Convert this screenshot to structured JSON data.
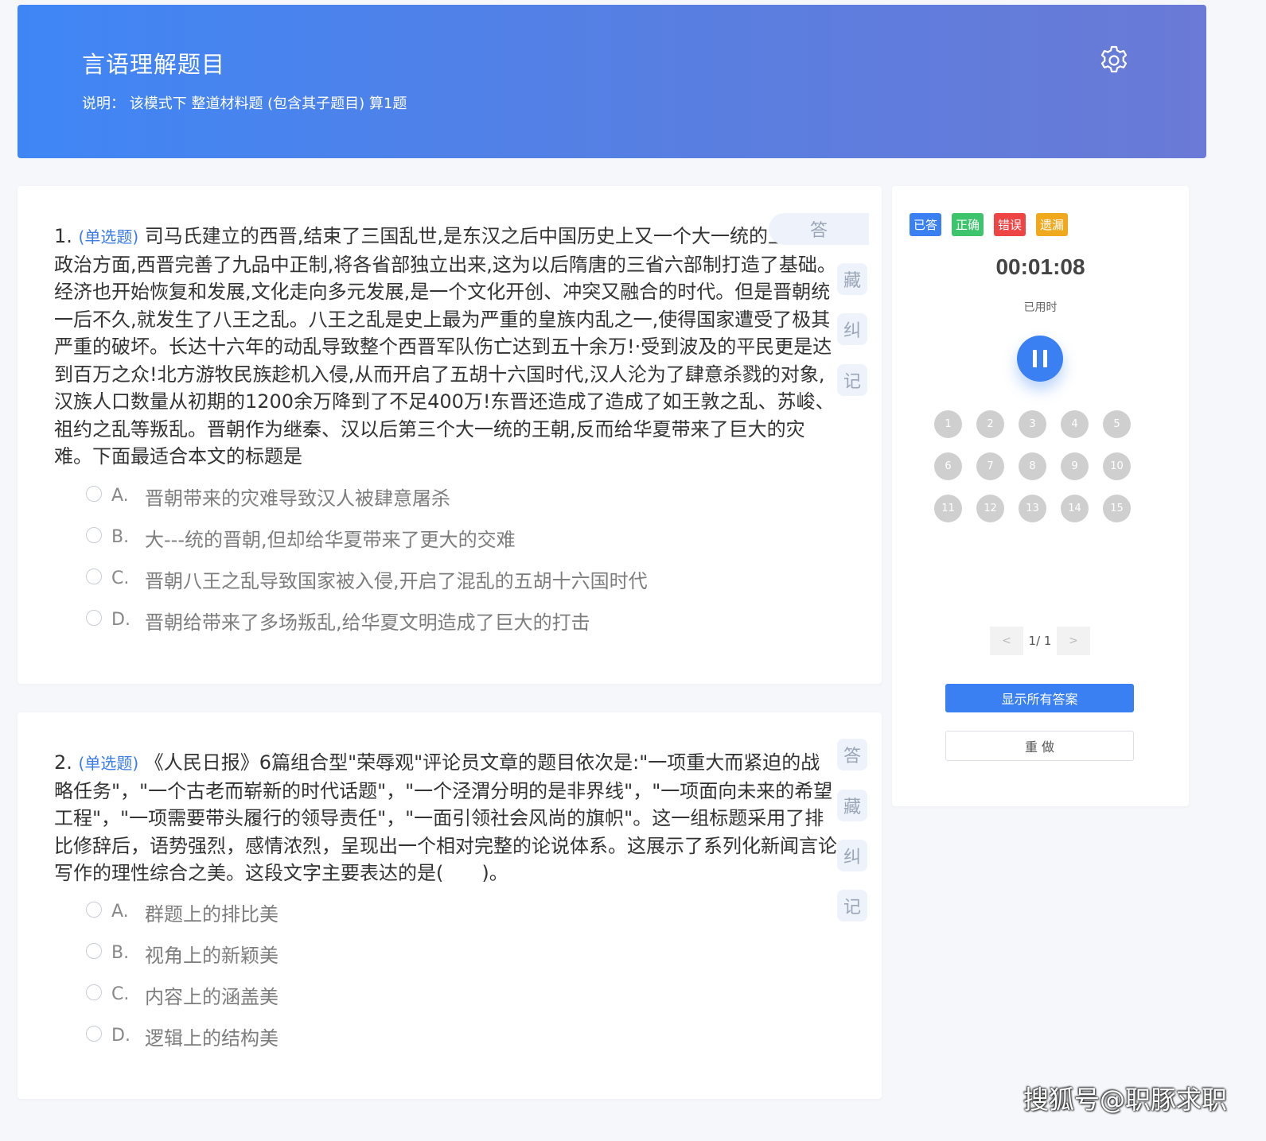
{
  "header": {
    "title": "言语理解题目",
    "note": "说明：  该模式下 整道材料题 (包含其子题目) 算1题",
    "settings_icon": "gear-icon"
  },
  "questions": [
    {
      "number": "1.",
      "type": "(单选题)",
      "stem": "司马氏建立的西晋,结束了三国乱世,是东汉之后中国历史上又一个大一统的王朝。政治方面,西晋完善了九品中正制,将各省部独立出来,这为以后隋唐的三省六部制打造了基础。经济也开始恢复和发展,文化走向多元发展,是一个文化开创、冲突又融合的时代。但是晋朝统一后不久,就发生了八王之乱。八王之乱是史上最为严重的皇族内乱之一,使得国家遭受了极其严重的破坏。长达十六年的动乱导致整个西晋军队伤亡达到五十余万!·受到波及的平民更是达到百万之众!北方游牧民族趁机入侵,从而开启了五胡十六国时代,汉人沦为了肆意杀戮的对象,汉族人口数量从初期的1200余万降到了不足400万!东晋还造成了造成了如王敦之乱、苏峻、祖约之乱等叛乱。晋朝作为继秦、汉以后第三个大一统的王朝,反而给华夏带来了巨大的灾难。下面最适合本文的标题是",
      "options": [
        {
          "key": "A.",
          "text": "晋朝带来的灾难导致汉人被肆意屠杀"
        },
        {
          "key": "B.",
          "text": "大---统的晋朝,但却给华夏带来了更大的交难"
        },
        {
          "key": "C.",
          "text": "晋朝八王之乱导致国家被入侵,开启了混乱的五胡十六国时代"
        },
        {
          "key": "D.",
          "text": "晋朝给带来了多场叛乱,给华夏文明造成了巨大的打击"
        }
      ],
      "side_buttons": [
        "答",
        "藏",
        "纠",
        "记"
      ]
    },
    {
      "number": "2.",
      "type": "(单选题)",
      "stem": "《人民日报》6篇组合型\"荣辱观\"评论员文章的题目依次是:\"一项重大而紧迫的战略任务\"，\"一个古老而崭新的时代话题\"，\"一个泾渭分明的是非界线\"，\"一项面向未来的希望工程\"，\"一项需要带头履行的领导责任\"，\"一面引领社会风尚的旗帜\"。这一组标题采用了排比修辞后，语势强烈，感情浓烈，呈现出一个相对完整的论说体系。这展示了系列化新闻言论写作的理性综合之美。这段文字主要表达的是(　　)。",
      "options": [
        {
          "key": "A.",
          "text": "群题上的排比美"
        },
        {
          "key": "B.",
          "text": "视角上的新颖美"
        },
        {
          "key": "C.",
          "text": "内容上的涵盖美"
        },
        {
          "key": "D.",
          "text": "逻辑上的结构美"
        }
      ],
      "side_buttons": [
        "答",
        "藏",
        "纠",
        "记"
      ]
    }
  ],
  "panel": {
    "legend": [
      {
        "label": "已答",
        "color": "#3a80f2"
      },
      {
        "label": "正确",
        "color": "#3ec46d"
      },
      {
        "label": "错误",
        "color": "#ee4444"
      },
      {
        "label": "遗漏",
        "color": "#f0a81c"
      }
    ],
    "timer": "00:01:08",
    "timer_label": "已用时",
    "pause_icon": "pause-icon",
    "question_numbers": [
      "1",
      "2",
      "3",
      "4",
      "5",
      "6",
      "7",
      "8",
      "9",
      "10",
      "11",
      "12",
      "13",
      "14",
      "15"
    ],
    "pager": {
      "prev": "<",
      "info": "1/ 1",
      "next": ">"
    },
    "show_answers_label": "显示所有答案",
    "redo_label": "重 做"
  },
  "watermark": "搜狐号@职豚求职"
}
